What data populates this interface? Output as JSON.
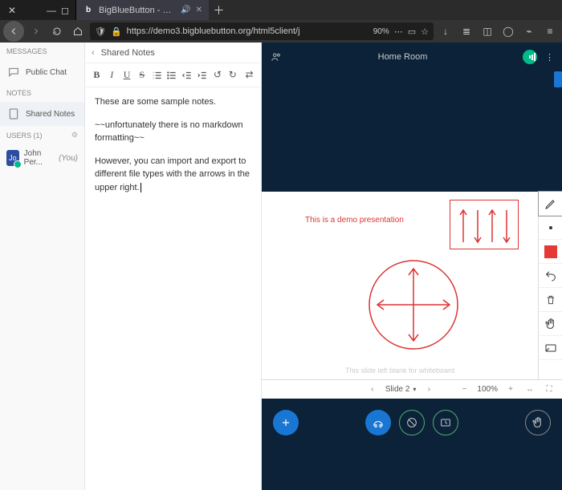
{
  "browser": {
    "tabs": [
      {
        "label": "",
        "active": false
      },
      {
        "label": "BigBlueButton - Home",
        "active": true
      }
    ],
    "url": "https://demo3.bigbluebutton.org/html5client/j",
    "zoom": "90%"
  },
  "sidebar": {
    "messages_label": "MESSAGES",
    "public_chat": "Public Chat",
    "notes_label": "NOTES",
    "shared_notes": "Shared Notes",
    "users_label": "USERS (1)",
    "user_initials": "Jo",
    "user_name": "John Per...",
    "you_label": "(You)"
  },
  "notes": {
    "title": "Shared Notes",
    "toolbar": {
      "bold": "B",
      "italic": "I",
      "underline": "U",
      "strike": "S",
      "ol": "ol",
      "ul": "ul",
      "outdent": "od",
      "indent": "id",
      "undo": "↺",
      "redo": "↻",
      "export": "⇄"
    },
    "p1": "These are some sample notes.",
    "p2": "~~unfortunately there is no markdown formatting~~",
    "p3": "However, you can import and export to different file types with the arrows in the upper right."
  },
  "main": {
    "room_title": "Home Room"
  },
  "slide": {
    "demo_label": "This is a demo presentation",
    "footer_text": "This slide left blank for whiteboard",
    "nav": {
      "current": "Slide 2",
      "zoom": "100%"
    }
  }
}
